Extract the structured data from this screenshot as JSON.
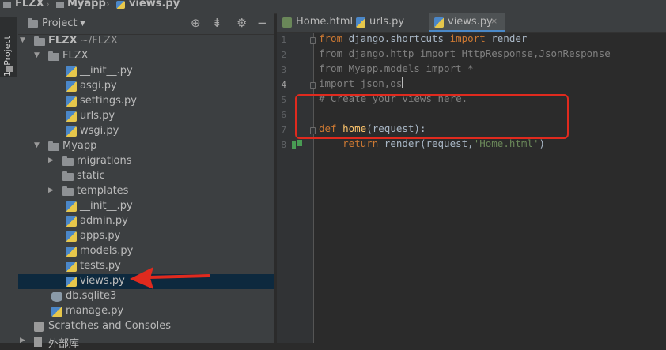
{
  "breadcrumb": {
    "items": [
      {
        "label": "FLZX"
      },
      {
        "label": "Myapp"
      },
      {
        "label": "views.py"
      }
    ]
  },
  "tool_stripe": {
    "project_tab": "1: Project"
  },
  "project_panel": {
    "title": "Project",
    "icons": [
      "locate-icon",
      "collapse-icon",
      "gear-icon",
      "hide-icon"
    ],
    "tree": [
      {
        "label": "FLZX",
        "suffix": "~/FLZX",
        "kind": "folder",
        "level": 0,
        "expanded": true
      },
      {
        "label": "FLZX",
        "kind": "folder",
        "level": 1,
        "expanded": true
      },
      {
        "label": "__init__.py",
        "kind": "py",
        "level": 2
      },
      {
        "label": "asgi.py",
        "kind": "py",
        "level": 2
      },
      {
        "label": "settings.py",
        "kind": "py",
        "level": 2
      },
      {
        "label": "urls.py",
        "kind": "py",
        "level": 2
      },
      {
        "label": "wsgi.py",
        "kind": "py",
        "level": 2
      },
      {
        "label": "Myapp",
        "kind": "folder",
        "level": 1,
        "expanded": true
      },
      {
        "label": "migrations",
        "kind": "folder",
        "level": 2,
        "expanded": false
      },
      {
        "label": "static",
        "kind": "folder",
        "level": 2
      },
      {
        "label": "templates",
        "kind": "folder",
        "level": 2,
        "expanded": false
      },
      {
        "label": "__init__.py",
        "kind": "py",
        "level": 2
      },
      {
        "label": "admin.py",
        "kind": "py",
        "level": 2
      },
      {
        "label": "apps.py",
        "kind": "py",
        "level": 2
      },
      {
        "label": "models.py",
        "kind": "py",
        "level": 2
      },
      {
        "label": "tests.py",
        "kind": "py",
        "level": 2
      },
      {
        "label": "views.py",
        "kind": "py",
        "level": 2,
        "selected": true
      },
      {
        "label": "db.sqlite3",
        "kind": "db",
        "level": 1
      },
      {
        "label": "manage.py",
        "kind": "py",
        "level": 1
      },
      {
        "label": "Scratches and Consoles",
        "kind": "scratch",
        "level": 0
      },
      {
        "label": "外部库",
        "kind": "lib",
        "level": 0
      }
    ]
  },
  "editor": {
    "tabs": [
      {
        "label": "Home.html",
        "icon": "html-file-icon",
        "active": false
      },
      {
        "label": "urls.py",
        "icon": "python-file-icon",
        "active": false
      },
      {
        "label": "views.py",
        "icon": "python-file-icon",
        "active": true
      }
    ],
    "close_glyph": "×",
    "line_numbers": [
      "1",
      "2",
      "3",
      "4",
      "5",
      "6",
      "7",
      "8"
    ],
    "current_line": "4",
    "code": {
      "l1_kw1": "from",
      "l1_mod": " django.shortcuts ",
      "l1_kw2": "import",
      "l1_name": " render",
      "l2": "from django.http import HttpResponse,JsonResponse",
      "l3": "from Myapp.models import *",
      "l4": "import json,os",
      "l5": "# Create your views here.",
      "l7_kw": "def",
      "l7_fn": "home",
      "l7_rest": "(request):",
      "l8_indent": "    ",
      "l8_kw": "return",
      "l8_call": " render(request,",
      "l8_str": "'Home.html'",
      "l8_end": ")"
    }
  },
  "colors": {
    "annotation": "#e02a1e",
    "selection": "#0d293e",
    "active_tab_underline": "#4a88c7"
  }
}
